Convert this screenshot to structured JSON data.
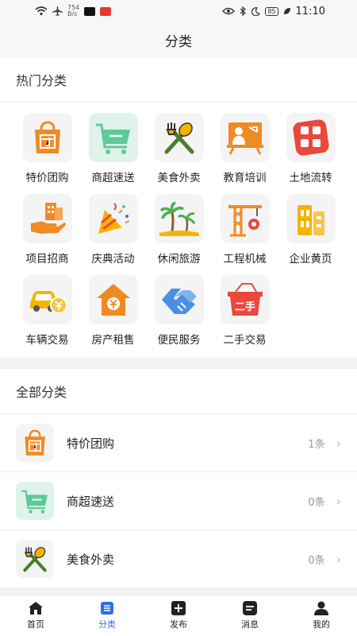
{
  "status_bar": {
    "speed_value": "754",
    "speed_unit": "B/s",
    "battery": "85",
    "time": "11:10"
  },
  "header": {
    "title": "分类"
  },
  "hot": {
    "title": "热门分类",
    "items": [
      {
        "label": "特价团购",
        "icon": "shopping-bag-icon"
      },
      {
        "label": "商超速送",
        "icon": "shopping-cart-icon"
      },
      {
        "label": "美食外卖",
        "icon": "fork-spoon-icon"
      },
      {
        "label": "教育培训",
        "icon": "teacher-board-icon"
      },
      {
        "label": "土地流转",
        "icon": "land-grid-icon"
      },
      {
        "label": "项目招商",
        "icon": "hand-building-icon"
      },
      {
        "label": "庆典活动",
        "icon": "party-popper-icon"
      },
      {
        "label": "休闲旅游",
        "icon": "palm-tree-icon"
      },
      {
        "label": "工程机械",
        "icon": "crane-icon"
      },
      {
        "label": "企业黄页",
        "icon": "office-building-icon"
      },
      {
        "label": "车辆交易",
        "icon": "car-coin-icon"
      },
      {
        "label": "房产租售",
        "icon": "house-yen-icon"
      },
      {
        "label": "便民服务",
        "icon": "handshake-icon"
      },
      {
        "label": "二手交易",
        "icon": "secondhand-basket-icon"
      }
    ],
    "basket_text": "二手"
  },
  "all": {
    "title": "全部分类",
    "rows": [
      {
        "label": "特价团购",
        "count": "1条",
        "icon": "shopping-bag-icon"
      },
      {
        "label": "商超速送",
        "count": "0条",
        "icon": "shopping-cart-icon"
      },
      {
        "label": "美食外卖",
        "count": "0条",
        "icon": "fork-spoon-icon"
      }
    ]
  },
  "tabbar": {
    "tabs": [
      {
        "label": "首页",
        "icon": "home-icon"
      },
      {
        "label": "分类",
        "icon": "category-list-icon",
        "active": true
      },
      {
        "label": "发布",
        "icon": "plus-square-icon"
      },
      {
        "label": "消息",
        "icon": "message-icon"
      },
      {
        "label": "我的",
        "icon": "person-icon"
      }
    ]
  },
  "colors": {
    "accent": "#2f6fe0",
    "orange": "#f08a24",
    "green": "#5fc99a",
    "red": "#e8493c"
  }
}
